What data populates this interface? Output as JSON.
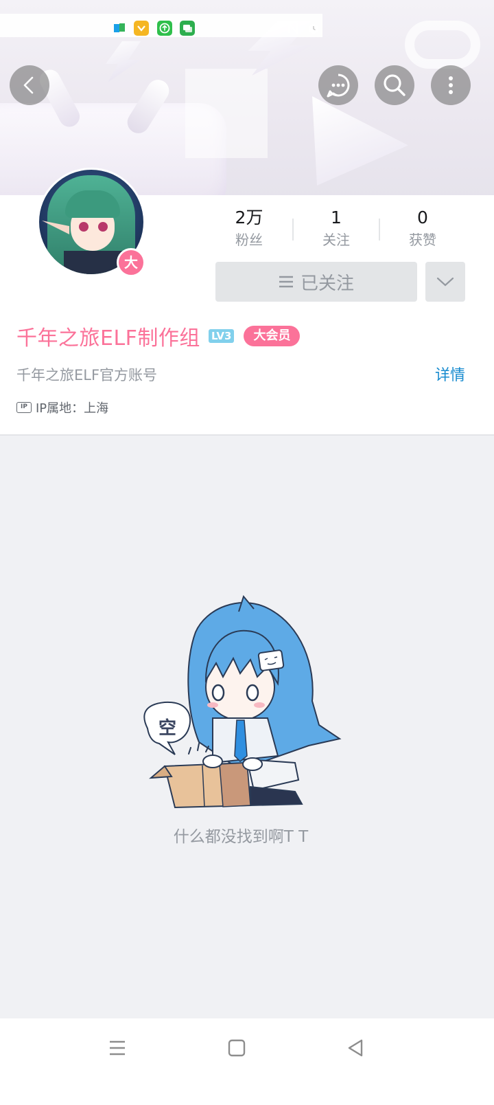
{
  "status_bar": {
    "icons": [
      "map-app-icon",
      "yellow-app-icon",
      "upload-app-icon",
      "message-app-icon",
      "nfc-icon",
      "alarm-icon"
    ]
  },
  "header": {
    "back": "chevron-left-icon",
    "message": "chat-bubble-icon",
    "search": "search-icon",
    "more": "more-vertical-icon"
  },
  "profile": {
    "avatar_badge": "大",
    "stats": [
      {
        "num": "2万",
        "label": "粉丝"
      },
      {
        "num": "1",
        "label": "关注"
      },
      {
        "num": "0",
        "label": "获赞"
      }
    ],
    "followed_label": "已关注",
    "name": "千年之旅ELF制作组",
    "level": "LV3",
    "vip": "大会员",
    "sign": "千年之旅ELF官方账号",
    "detail": "详情",
    "ip_icon": "IP",
    "ip_location": "IP属地：上海"
  },
  "empty": {
    "bubble": "空",
    "message": "什么都没找到啊T T"
  },
  "colors": {
    "accent_pink": "#fb7299",
    "link_blue": "#178bcf",
    "level_blue": "#81d0ec"
  }
}
